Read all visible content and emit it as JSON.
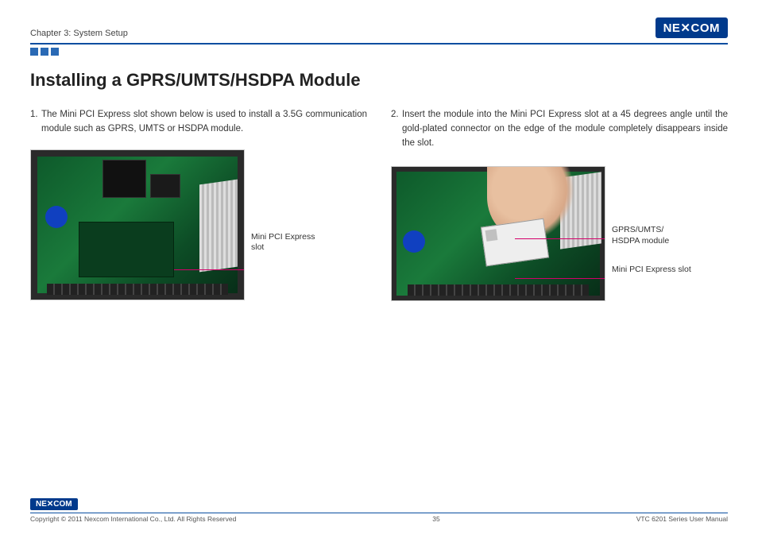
{
  "header": {
    "chapter": "Chapter 3: System Setup",
    "brand": "NE✕COM"
  },
  "title": "Installing a GPRS/UMTS/HSDPA Module",
  "left": {
    "step_num": "1.",
    "step_text": "The Mini PCI Express slot shown below is used to install a 3.5G communication module such as GPRS, UMTS or HSDPA module.",
    "label_slot": "Mini PCI Express slot"
  },
  "right": {
    "step_num": "2.",
    "step_text": "Insert the module into the Mini PCI Express slot at a 45 degrees angle until the gold-plated connector on the edge of the module completely disappears inside the slot.",
    "label_module": "GPRS/UMTS/ HSDPA module",
    "label_slot": "Mini PCI Express slot"
  },
  "footer": {
    "brand": "NE✕COM",
    "copyright": "Copyright © 2011 Nexcom International Co., Ltd. All Rights Reserved",
    "page_number": "35",
    "doc_title": "VTC 6201 Series User Manual"
  }
}
